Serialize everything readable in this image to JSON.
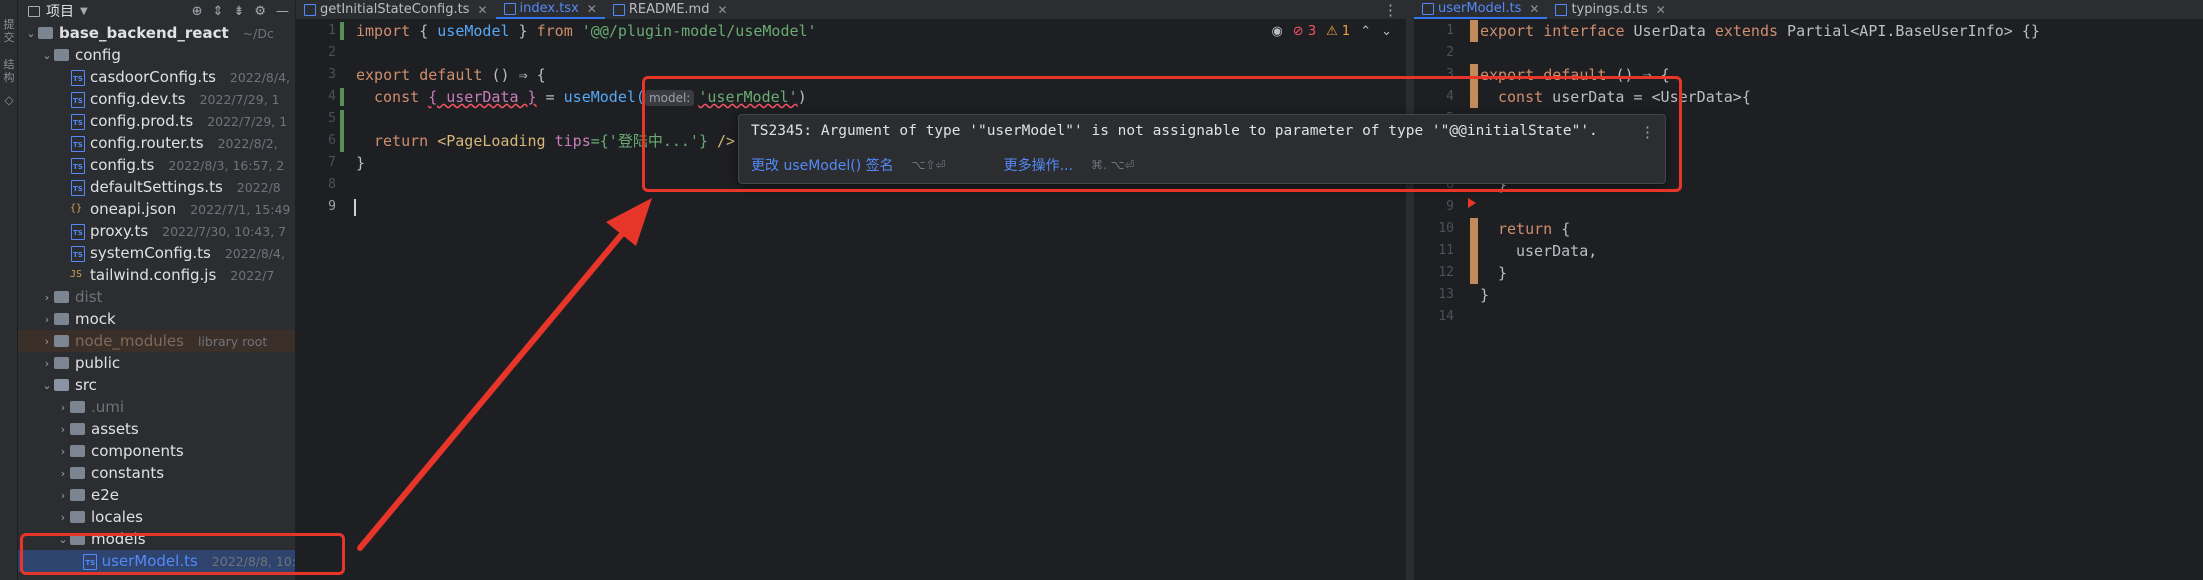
{
  "toolstrip": {
    "items": [
      "提交",
      "结构"
    ]
  },
  "project": {
    "title": "项目",
    "rows": [
      {
        "name": "base_backend_react",
        "meta": "~/Dc",
        "kind": "root-folder",
        "depth": 0,
        "arrow": "open"
      },
      {
        "name": "config",
        "meta": "",
        "kind": "folder",
        "depth": 1,
        "arrow": "open"
      },
      {
        "name": "casdoorConfig.ts",
        "meta": "2022/8/4,",
        "kind": "ts",
        "depth": 2
      },
      {
        "name": "config.dev.ts",
        "meta": "2022/7/29, 1",
        "kind": "ts",
        "depth": 2
      },
      {
        "name": "config.prod.ts",
        "meta": "2022/7/29, 1",
        "kind": "ts",
        "depth": 2
      },
      {
        "name": "config.router.ts",
        "meta": "2022/8/2,",
        "kind": "ts",
        "depth": 2
      },
      {
        "name": "config.ts",
        "meta": "2022/8/3, 16:57, 2",
        "kind": "ts",
        "depth": 2
      },
      {
        "name": "defaultSettings.ts",
        "meta": "2022/8",
        "kind": "ts",
        "depth": 2
      },
      {
        "name": "oneapi.json",
        "meta": "2022/7/1, 15:49",
        "kind": "json",
        "depth": 2
      },
      {
        "name": "proxy.ts",
        "meta": "2022/7/30, 10:43, 7",
        "kind": "ts",
        "depth": 2
      },
      {
        "name": "systemConfig.ts",
        "meta": "2022/8/4,",
        "kind": "ts",
        "depth": 2
      },
      {
        "name": "tailwind.config.js",
        "meta": "2022/7",
        "kind": "js",
        "depth": 2
      },
      {
        "name": "dist",
        "meta": "",
        "kind": "folder-dim",
        "depth": 1,
        "arrow": "closed"
      },
      {
        "name": "mock",
        "meta": "",
        "kind": "folder",
        "depth": 1,
        "arrow": "closed"
      },
      {
        "name": "node_modules",
        "meta": "library root",
        "kind": "folder-excluded",
        "depth": 1,
        "arrow": "closed"
      },
      {
        "name": "public",
        "meta": "",
        "kind": "folder",
        "depth": 1,
        "arrow": "closed"
      },
      {
        "name": "src",
        "meta": "",
        "kind": "folder-src",
        "depth": 1,
        "arrow": "open"
      },
      {
        "name": ".umi",
        "meta": "",
        "kind": "folder-dim",
        "depth": 2,
        "arrow": "closed"
      },
      {
        "name": "assets",
        "meta": "",
        "kind": "folder",
        "depth": 2,
        "arrow": "closed"
      },
      {
        "name": "components",
        "meta": "",
        "kind": "folder",
        "depth": 2,
        "arrow": "closed"
      },
      {
        "name": "constants",
        "meta": "",
        "kind": "folder",
        "depth": 2,
        "arrow": "closed"
      },
      {
        "name": "e2e",
        "meta": "",
        "kind": "folder",
        "depth": 2,
        "arrow": "closed"
      },
      {
        "name": "locales",
        "meta": "",
        "kind": "folder",
        "depth": 2,
        "arrow": "closed"
      },
      {
        "name": "models",
        "meta": "",
        "kind": "folder",
        "depth": 2,
        "arrow": "open"
      },
      {
        "name": "userModel.ts",
        "meta": "2022/8/8, 10:",
        "kind": "ts-selected",
        "depth": 3
      }
    ]
  },
  "tabs_left": [
    {
      "label": "getInitialStateConfig.ts",
      "kind": "ts"
    },
    {
      "label": "index.tsx",
      "kind": "tsx",
      "active": true
    },
    {
      "label": "README.md",
      "kind": "md"
    }
  ],
  "tabs_right": [
    {
      "label": "userModel.ts",
      "kind": "ts",
      "active": true
    },
    {
      "label": "typings.d.ts",
      "kind": "ts"
    }
  ],
  "inspections": {
    "errors": "3",
    "warnings": "1"
  },
  "editor_left": {
    "line_numbers": [
      "1",
      "2",
      "3",
      "4",
      "5",
      "6",
      "7",
      "8",
      "9"
    ],
    "line1": {
      "kw1": "import",
      "p1": " { ",
      "name": "useModel",
      "p2": " } ",
      "kw2": "from",
      "str": " '@@/plugin-model/useModel'"
    },
    "line3": {
      "kw1": "export default",
      "p1": " () ",
      "arrow": "⇒",
      "p2": " {"
    },
    "line4": {
      "kw": "const",
      "destructure": "{ userData }",
      "eq": " = ",
      "fn": "useModel(",
      "hint": "model:",
      "arg": "'userModel'",
      "close": ")"
    },
    "line6": {
      "kw": "return",
      "tag_open": " <PageLoading ",
      "attr": "tips",
      "val": "={'登陆中...'} ",
      "tag_close": "/>"
    },
    "line7": "}"
  },
  "popup": {
    "message": "TS2345: Argument of type '\"userModel\"' is not assignable to parameter of type '\"@@initialState\"'.",
    "action1": "更改 useModel() 签名",
    "key1": "⌥⇧⏎",
    "action2": "更多操作...",
    "key2": "⌘. ⌥⏎"
  },
  "editor_right": {
    "line_numbers": [
      "1",
      "2",
      "3",
      "4",
      "5",
      "6",
      "7",
      "8",
      "9",
      "10",
      "11",
      "12",
      "13",
      "14"
    ],
    "line1": {
      "kw": "export interface",
      "name": " UserData ",
      "kw2": "extends",
      "rest": " Partial<API.BaseUserInfo> {}"
    },
    "line3": {
      "kw": "export default",
      "rest": " () ",
      "arrow": "⇒",
      "brace": " {"
    },
    "line4": {
      "kw": "const",
      "name": " userData",
      "rest": " = <UserData>{"
    },
    "line8": "}",
    "line10": {
      "kw": "return",
      "rest": " {"
    },
    "line11": "userData,",
    "line12": "}",
    "line13": "}"
  },
  "colors": {
    "accent": "#3574f0",
    "annotation": "#e8352a",
    "error": "#f75464"
  }
}
